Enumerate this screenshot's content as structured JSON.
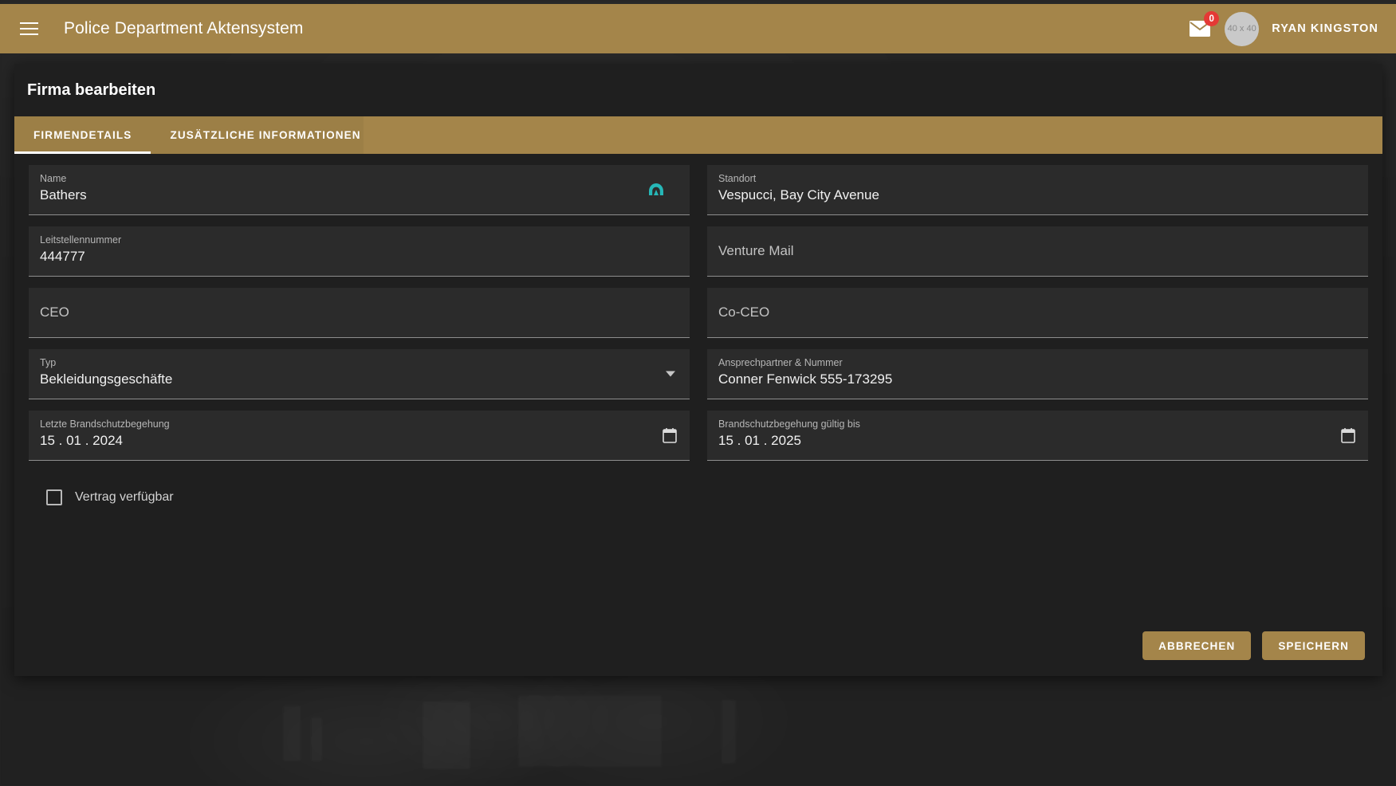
{
  "topbar": {
    "menu_icon": "hamburger-menu-icon",
    "title": "Police Department Aktensystem",
    "mail_icon": "mail-icon",
    "mail_badge": "0",
    "avatar_text": "40 x 40",
    "username": "RYAN KINGSTON",
    "background_color": "#a4854a"
  },
  "dialog": {
    "title": "Firma bearbeiten",
    "tabs": [
      {
        "label": "FIRMENDETAILS",
        "active": true
      },
      {
        "label": "ZUSÄTZLICHE INFORMATIONEN",
        "active": false
      }
    ],
    "fields": {
      "name": {
        "label": "Name",
        "value": "Bathers",
        "icon": "autofill-arch-icon",
        "icon_color": "#26b7b7"
      },
      "standort": {
        "label": "Standort",
        "value": "Vespucci, Bay City Avenue"
      },
      "leitstellennummer": {
        "label": "Leitstellennummer",
        "value": "444777"
      },
      "venture_mail": {
        "placeholder": "Venture Mail",
        "value": ""
      },
      "ceo": {
        "placeholder": "CEO",
        "value": ""
      },
      "co_ceo": {
        "placeholder": "Co-CEO",
        "value": ""
      },
      "typ": {
        "label": "Typ",
        "value": "Bekleidungsgeschäfte",
        "icon": "chevron-down-icon"
      },
      "ansprechpartner": {
        "label": "Ansprechpartner & Nummer",
        "value": "Conner Fenwick 555-173295"
      },
      "letzte_brandschutzbegehung": {
        "label": "Letzte Brandschutzbegehung",
        "value": "15 . 01 . 2024",
        "icon": "calendar-icon"
      },
      "brandschutzbegehung_gueltig_bis": {
        "label": "Brandschutzbegehung gültig bis",
        "value": "15 . 01 . 2025",
        "icon": "calendar-icon"
      }
    },
    "checkbox": {
      "label": "Vertrag verfügbar",
      "checked": false
    },
    "buttons": {
      "cancel": "ABBRECHEN",
      "save": "SPEICHERN"
    }
  }
}
